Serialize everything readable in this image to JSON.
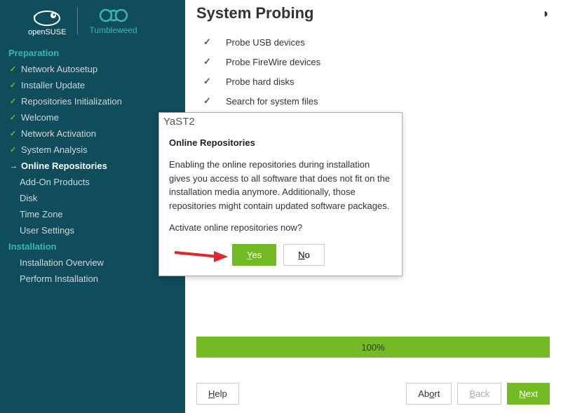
{
  "brand": {
    "opensuse": "openSUSE",
    "tumbleweed": "Tumbleweed"
  },
  "nav": {
    "section1": "Preparation",
    "items1": [
      {
        "label": "Network Autosetup",
        "state": "done"
      },
      {
        "label": "Installer Update",
        "state": "done"
      },
      {
        "label": "Repositories Initialization",
        "state": "done"
      },
      {
        "label": "Welcome",
        "state": "done"
      },
      {
        "label": "Network Activation",
        "state": "done"
      },
      {
        "label": "System Analysis",
        "state": "done"
      },
      {
        "label": "Online Repositories",
        "state": "current"
      },
      {
        "label": "Add-On Products",
        "state": "pending"
      },
      {
        "label": "Disk",
        "state": "pending"
      },
      {
        "label": "Time Zone",
        "state": "pending"
      },
      {
        "label": "User Settings",
        "state": "pending"
      }
    ],
    "section2": "Installation",
    "items2": [
      {
        "label": "Installation Overview",
        "state": "pending"
      },
      {
        "label": "Perform Installation",
        "state": "pending"
      }
    ]
  },
  "main": {
    "title": "System Probing",
    "probes": [
      "Probe USB devices",
      "Probe FireWire devices",
      "Probe hard disks",
      "Search for system files"
    ],
    "progress_label": "100%"
  },
  "footer": {
    "help": "Help",
    "abort": "Abort",
    "back": "Back",
    "next": "Next"
  },
  "dialog": {
    "window_title": "YaST2",
    "heading": "Online Repositories",
    "text": "Enabling the online repositories during installation gives you access to all software that does not fit on the installation media anymore. Additionally, those repositories might contain updated software packages.",
    "question": "Activate online repositories now?",
    "yes": "Yes",
    "no": "No"
  }
}
